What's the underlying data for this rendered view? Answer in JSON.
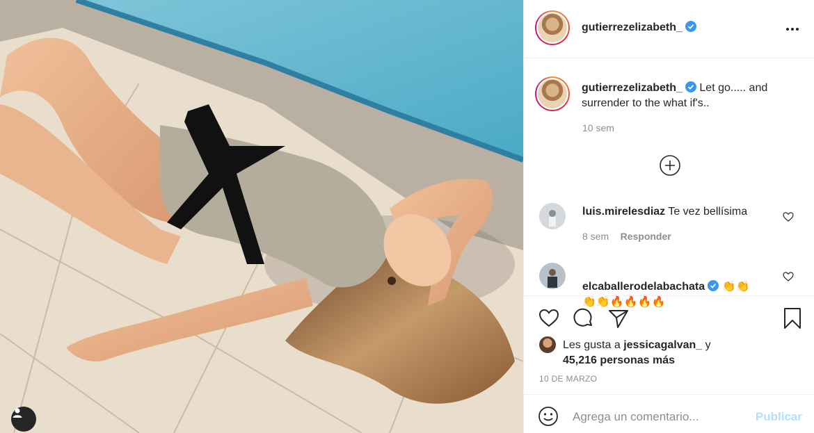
{
  "post": {
    "author": "gutierrezelizabeth_",
    "verified": true,
    "photo_description_icon": "photo-of-woman-by-pool"
  },
  "caption": {
    "username": "gutierrezelizabeth_",
    "text": "Let go..... and surrender to the what if's..",
    "time": "10 sem"
  },
  "comments": [
    {
      "username": "luis.mirelesdiaz",
      "text": "Te vez bellísima",
      "time": "8 sem",
      "reply_label": "Responder"
    },
    {
      "username": "elcaballerodelabachata",
      "text": "👏👏\n👏👏🔥🔥🔥🔥",
      "verified": true
    }
  ],
  "likes": {
    "prefix": "Les gusta a",
    "user": "jessicagalvan_",
    "suffix": "y",
    "count_text": "45,216 personas más"
  },
  "date": "10 DE MARZO",
  "comment_box": {
    "placeholder": "Agrega un comentario...",
    "post_label": "Publicar"
  },
  "colors": {
    "verified_blue": "#3897f0",
    "post_disabled": "#b2dffc",
    "meta_gray": "#8e8e8e"
  }
}
